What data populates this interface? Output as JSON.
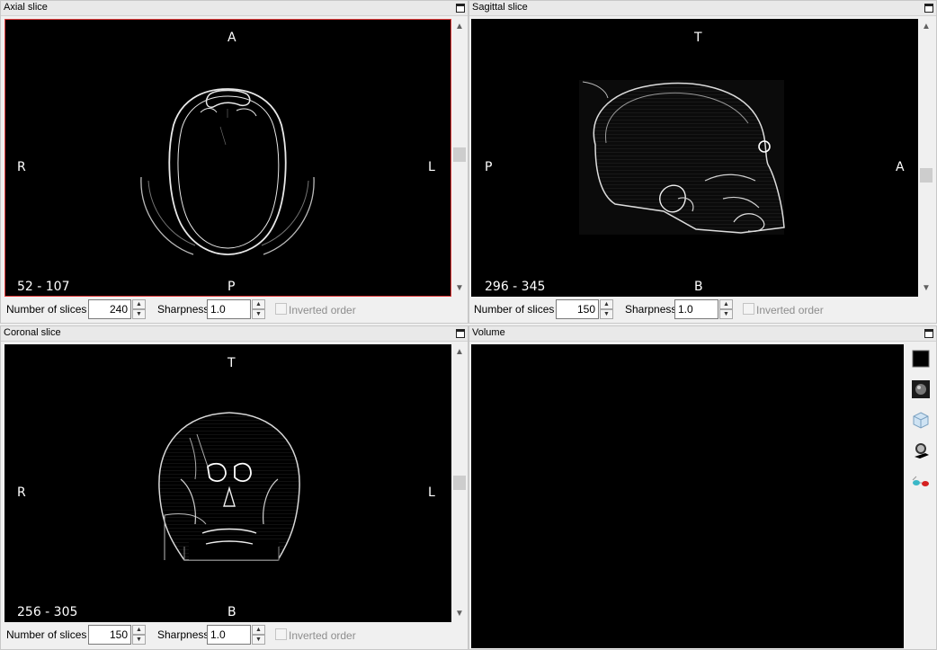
{
  "axial": {
    "title": "Axial slice",
    "labels": {
      "top": "A",
      "left": "R",
      "right": "L",
      "bottom": "P"
    },
    "range": "52 - 107",
    "num_slices_label": "Number of slices",
    "num_slices": "240",
    "sharpness_label": "Sharpness",
    "sharpness": "1.0",
    "inverted_label": "Inverted order"
  },
  "sagittal": {
    "title": "Sagittal slice",
    "labels": {
      "top": "T",
      "left": "P",
      "right": "A",
      "bottom": "B"
    },
    "range": "296 - 345",
    "num_slices_label": "Number of slices",
    "num_slices": "150",
    "sharpness_label": "Sharpness",
    "sharpness": "1.0",
    "inverted_label": "Inverted order"
  },
  "coronal": {
    "title": "Coronal slice",
    "labels": {
      "top": "T",
      "left": "R",
      "right": "L",
      "bottom": "B"
    },
    "range": "256 - 305",
    "num_slices_label": "Number of slices",
    "num_slices": "150",
    "sharpness_label": "Sharpness",
    "sharpness": "1.0",
    "inverted_label": "Inverted order"
  },
  "volume": {
    "title": "Volume",
    "tools": [
      "background-color-icon",
      "volume-render-icon",
      "cube-icon",
      "head-3d-icon",
      "stereo-glasses-icon"
    ]
  },
  "colors": {
    "active_border": "#e23b3b",
    "viewport_bg": "#000000",
    "panel_bg": "#f0f0f0"
  }
}
